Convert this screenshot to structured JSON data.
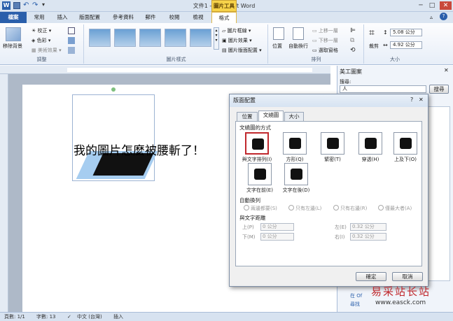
{
  "titlebar": {
    "title": "文件1 - Microsoft Word",
    "tools_tab": "圖片工具",
    "help": "?"
  },
  "tabs": [
    "檔案",
    "常用",
    "插入",
    "版面配置",
    "參考資料",
    "郵件",
    "校閱",
    "檢視",
    "格式"
  ],
  "ribbon": {
    "remove_bg": "移除背景",
    "corrections": "校正",
    "color": "色彩",
    "artistic": "美術效果",
    "adjust_group": "調整",
    "border": "圖片框線",
    "effects": "圖片效果",
    "layout": "圖片版面配置",
    "styles_group": "圖片樣式",
    "position": "位置",
    "wrap": "自動換行",
    "bring_forward": "上移一層",
    "send_backward": "下移一層",
    "selection_pane": "選取窗格",
    "arrange_group": "排列",
    "crop": "裁剪",
    "height": "5.08 公分",
    "width": "4.92 公分",
    "size_group": "大小"
  },
  "document": {
    "caption": "我的圖片怎麼被腰斬了！"
  },
  "clipart": {
    "title": "美工圖案",
    "search_label": "搜尋:",
    "search_value": "人",
    "search_button": "搜尋",
    "link1": "在 Of",
    "link2": "尋找"
  },
  "dialog": {
    "title": "版面配置",
    "help": "?",
    "tabs": [
      "位置",
      "文繞圖",
      "大小"
    ],
    "wrap_section": "文繞圖的方式",
    "wrap_options": [
      "與文字排列(I)",
      "方形(Q)",
      "緊密(T)",
      "穿透(H)",
      "上及下(O)",
      "文字在前(E)",
      "文字在後(D)"
    ],
    "auto_section": "自動換列",
    "auto_options": [
      "兩邊都要(S)",
      "只有左邊(L)",
      "只有右邊(R)",
      "僅最大者(A)"
    ],
    "distance_section": "與文字距離",
    "top_label": "上(P)",
    "top_value": "0 公分",
    "bottom_label": "下(M)",
    "bottom_value": "0 公分",
    "left_label": "左(E)",
    "left_value": "0.32 公分",
    "right_label": "右(I)",
    "right_value": "0.32 公分",
    "ok": "確定",
    "cancel": "取消"
  },
  "status": {
    "page": "頁數: 1/1",
    "words": "字數: 13",
    "lang": "中文 (台灣)",
    "mode": "插入"
  },
  "watermark": {
    "text": "易采站长站",
    "url": "www.easck.com"
  },
  "colors": {
    "accent": "#2a5fab",
    "tools": "#f7d34a",
    "selected_wrap": "#c0282d"
  }
}
